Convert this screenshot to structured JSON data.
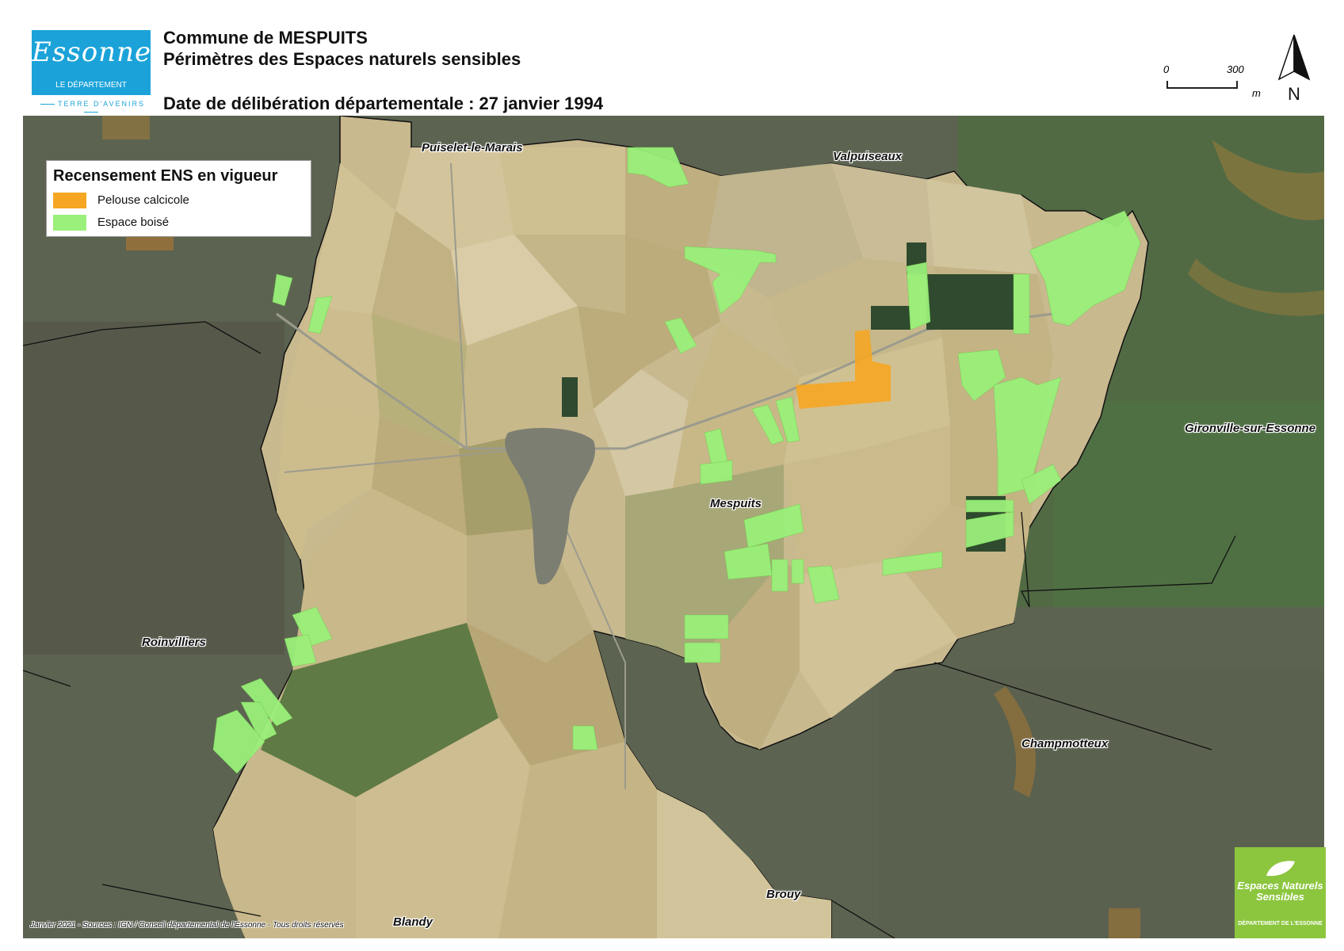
{
  "header": {
    "title_line1": "Commune de MESPUITS",
    "title_line2": "Périmètres des Espaces naturels sensibles",
    "date_line": "Date de délibération départementale : 27 janvier 1994"
  },
  "logo": {
    "script": "Essonne",
    "subtitle": "LE DÉPARTEMENT",
    "tagline": "TERRE D'AVENIRS",
    "color": "#1ba3d9"
  },
  "scale": {
    "start": "0",
    "end": "300",
    "unit": "m"
  },
  "north_arrow": {
    "label": "N",
    "icon": "north-arrow-icon"
  },
  "legend": {
    "title": "Recensement ENS en vigueur",
    "items": [
      {
        "label": "Pelouse calcicole",
        "color": "#f5a623"
      },
      {
        "label": "Espace boisé",
        "color": "#9af07a"
      }
    ]
  },
  "places": {
    "puiselet": "Puiselet-le-Marais",
    "valpuiseaux": "Valpuiseaux",
    "mespuits": "Mespuits",
    "gironville": "Gironville-sur-Essonne",
    "roinvilliers": "Roinvilliers",
    "champmotteux": "Champmotteux",
    "brouy": "Brouy",
    "blandy": "Blandy"
  },
  "credits": "Janvier 2021 - Sources : IGN / Conseil départemental de l'Essonne - Tous droits réservés",
  "ens_logo": {
    "line1": "Espaces Naturels Sensibles",
    "line2": "DÉPARTEMENT DE L'ESSONNE",
    "color": "#8cc63f"
  }
}
